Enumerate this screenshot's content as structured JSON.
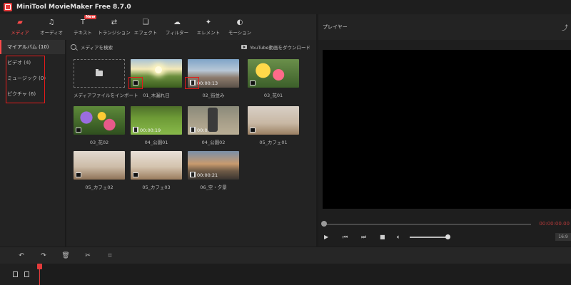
{
  "app": {
    "title": "MiniTool MovieMaker Free 8.7.0"
  },
  "toolbar": {
    "items": [
      {
        "label": "メディア",
        "icon": "folder-icon",
        "glyph": "▰"
      },
      {
        "label": "オーディオ",
        "icon": "music-note-icon",
        "glyph": "♫"
      },
      {
        "label": "テキスト",
        "icon": "text-icon",
        "glyph": "T",
        "badge": "New"
      },
      {
        "label": "トランジション",
        "icon": "transition-icon",
        "glyph": "⇄"
      },
      {
        "label": "エフェクト",
        "icon": "effect-icon",
        "glyph": "❏"
      },
      {
        "label": "フィルター",
        "icon": "filter-icon",
        "glyph": "☁"
      },
      {
        "label": "エレメント",
        "icon": "element-icon",
        "glyph": "✦"
      },
      {
        "label": "モーション",
        "icon": "motion-icon",
        "glyph": "◐"
      }
    ],
    "active_index": 0
  },
  "sidebar": {
    "album": "マイアルバム (10)",
    "items": [
      "ビデオ (4)",
      "ミュージック (0)",
      "ピクチャ (6)"
    ]
  },
  "media": {
    "search_placeholder": "メディアを検索",
    "youtube_label": "YouTube動画をダウンロード",
    "import_label": "メディアファイルをインポート",
    "clips": [
      {
        "name": "01_木漏れ日",
        "kind": "picture",
        "duration": ""
      },
      {
        "name": "02_街並み",
        "kind": "video",
        "duration": "00:00:13"
      },
      {
        "name": "03_花01",
        "kind": "picture",
        "duration": ""
      },
      {
        "name": "03_花02",
        "kind": "picture",
        "duration": ""
      },
      {
        "name": "04_公園01",
        "kind": "video",
        "duration": "00:00:19"
      },
      {
        "name": "04_公園02",
        "kind": "video",
        "duration": "00:00:07"
      },
      {
        "name": "05_カフェ01",
        "kind": "picture",
        "duration": ""
      },
      {
        "name": "05_カフェ02",
        "kind": "picture",
        "duration": ""
      },
      {
        "name": "05_カフェ03",
        "kind": "picture",
        "duration": ""
      },
      {
        "name": "06_空・夕景",
        "kind": "video",
        "duration": "00:00:21"
      }
    ]
  },
  "player": {
    "title": "プレイヤー",
    "time": "00:00:00.00",
    "ratio": "16:9"
  },
  "colors": {
    "accent": "#ff4b4b",
    "highlight_box": "#e31b1b",
    "background": "#1b1b1b"
  }
}
